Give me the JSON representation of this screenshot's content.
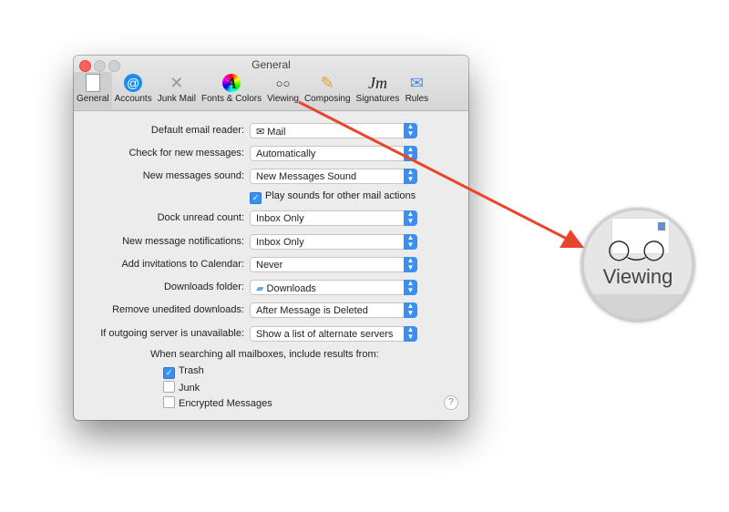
{
  "window": {
    "title": "General"
  },
  "toolbar": [
    {
      "label": "General",
      "icon": "general-switch-icon",
      "selected": true
    },
    {
      "label": "Accounts",
      "icon": "at-icon"
    },
    {
      "label": "Junk Mail",
      "icon": "junk-bin-icon"
    },
    {
      "label": "Fonts & Colors",
      "icon": "fonts-colors-icon"
    },
    {
      "label": "Viewing",
      "icon": "glasses-icon"
    },
    {
      "label": "Composing",
      "icon": "pencil-icon"
    },
    {
      "label": "Signatures",
      "icon": "signature-icon"
    },
    {
      "label": "Rules",
      "icon": "rules-icon"
    }
  ],
  "settings": [
    {
      "label": "Default email reader:",
      "value": "Mail"
    },
    {
      "label": "Check for new messages:",
      "value": "Automatically"
    },
    {
      "label": "New messages sound:",
      "value": "New Messages Sound"
    },
    {
      "label": "Dock unread count:",
      "value": "Inbox Only"
    },
    {
      "label": "New message notifications:",
      "value": "Inbox Only"
    },
    {
      "label": "Add invitations to Calendar:",
      "value": "Never"
    },
    {
      "label": "Downloads folder:",
      "value": "Downloads"
    },
    {
      "label": "Remove unedited downloads:",
      "value": "After Message is Deleted"
    },
    {
      "label": "If outgoing server is unavailable:",
      "value": "Show a list of alternate servers"
    }
  ],
  "play_sounds": {
    "label": "Play sounds for other mail actions",
    "checked": true
  },
  "search": {
    "heading": "When searching all mailboxes, include results from:",
    "options": [
      {
        "label": "Trash",
        "checked": true
      },
      {
        "label": "Junk",
        "checked": false
      },
      {
        "label": "Encrypted Messages",
        "checked": false
      }
    ]
  },
  "help": "?",
  "callout": {
    "label": "Viewing",
    "arrow_color": "#e8452c"
  }
}
